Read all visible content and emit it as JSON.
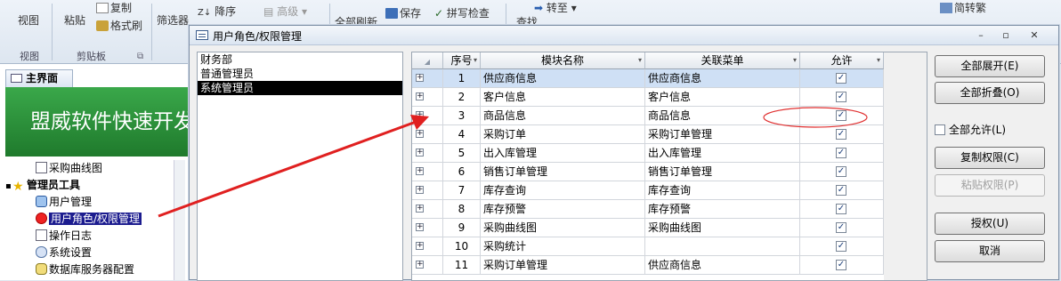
{
  "ribbon": {
    "view_label": "视图",
    "view_group": "视图",
    "paste_label": "粘贴",
    "copy_label": "复制",
    "format_painter_label": "格式刷",
    "clipboard_group": "剪贴板",
    "filter_label": "筛选器",
    "descending_label": "降序",
    "advanced_label": "高级",
    "refresh_all_label": "全部刷新",
    "save_label": "保存",
    "spellcheck_label": "拼写检查",
    "find_label": "查找",
    "goto_label": "转至",
    "convert_label": "简转繁"
  },
  "navpane": {
    "header": "主界面",
    "banner": "盟威软件快速开发",
    "tree": [
      {
        "label": "采购曲线图",
        "icon": "report-icon"
      },
      {
        "label": "管理员工具",
        "icon": "star-icon"
      },
      {
        "label": "用户管理",
        "icon": "users-icon"
      },
      {
        "label": "用户角色/权限管理",
        "icon": "no-entry-icon"
      },
      {
        "label": "操作日志",
        "icon": "document-icon"
      },
      {
        "label": "系统设置",
        "icon": "settings-icon"
      },
      {
        "label": "数据库服务器配置",
        "icon": "database-icon"
      }
    ]
  },
  "dialog": {
    "title": "用户角色/权限管理",
    "minimize": "–",
    "restore": "▫",
    "close": "✕",
    "roles": [
      "财务部",
      "普通管理员",
      "系统管理员"
    ],
    "selected_role": "系统管理员",
    "columns": {
      "seq": "序号",
      "module": "模块名称",
      "menu": "关联菜单",
      "allow": "允许"
    },
    "rows": [
      {
        "seq": "1",
        "module": "供应商信息",
        "menu": "供应商信息",
        "allow": true
      },
      {
        "seq": "2",
        "module": "客户信息",
        "menu": "客户信息",
        "allow": true
      },
      {
        "seq": "3",
        "module": "商品信息",
        "menu": "商品信息",
        "allow": true
      },
      {
        "seq": "4",
        "module": "采购订单",
        "menu": "采购订单管理",
        "allow": true
      },
      {
        "seq": "5",
        "module": "出入库管理",
        "menu": "出入库管理",
        "allow": true
      },
      {
        "seq": "6",
        "module": "销售订单管理",
        "menu": "销售订单管理",
        "allow": true
      },
      {
        "seq": "7",
        "module": "库存查询",
        "menu": "库存查询",
        "allow": true
      },
      {
        "seq": "8",
        "module": "库存预警",
        "menu": "库存预警",
        "allow": true
      },
      {
        "seq": "9",
        "module": "采购曲线图",
        "menu": "采购曲线图",
        "allow": true
      },
      {
        "seq": "10",
        "module": "采购统计",
        "menu": "",
        "allow": true
      },
      {
        "seq": "11",
        "module": "采购订单管理",
        "menu": "供应商信息",
        "allow": true
      }
    ],
    "buttons": {
      "expand_all": "全部展开(E)",
      "collapse_all": "全部折叠(O)",
      "allow_all": "全部允许(L)",
      "copy_perms": "复制权限(C)",
      "paste_perms": "粘贴权限(P)",
      "authorize": "授权(U)",
      "cancel": "取消"
    }
  },
  "colors": {
    "banner_green": "#2a9138",
    "annotation_red": "#e02020",
    "selected_row": "#cfe0f5",
    "selected_role": "#000000"
  }
}
